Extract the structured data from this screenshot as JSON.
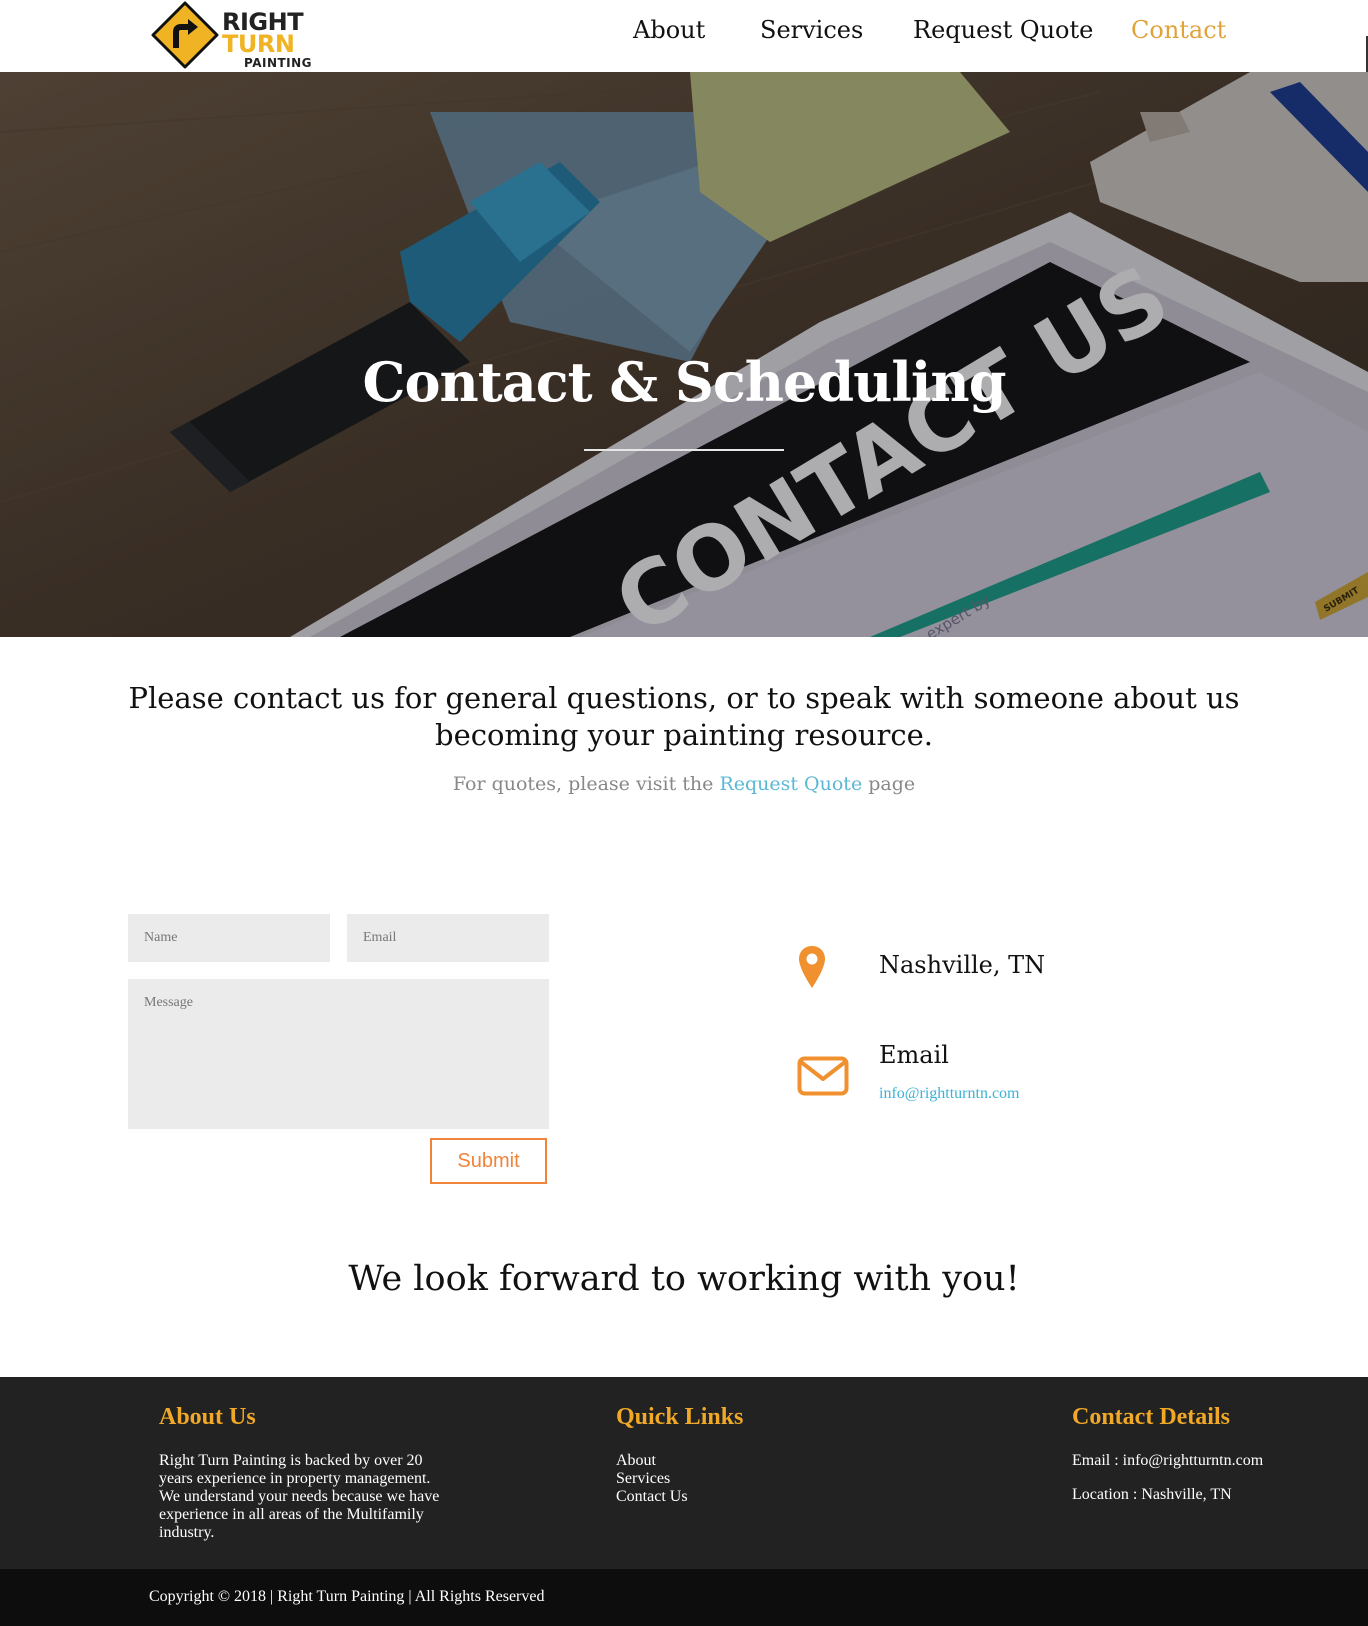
{
  "header": {
    "logo": {
      "line1": "RIGHT",
      "line2": "TURN",
      "line3": "PAINTING",
      "icon": "turn-arrow-sign-icon"
    },
    "nav": {
      "about": "About",
      "services": "Services",
      "request_quote": "Request Quote",
      "contact": "Contact"
    },
    "active_nav": "Contact",
    "active_color": "#e0a33a"
  },
  "hero": {
    "title": "Contact & Scheduling",
    "image_text": "CONTACT US",
    "image_small_text": "an expert by",
    "image_button_text": "SUBMIT"
  },
  "intro": {
    "heading": "Please contact us for general questions, or to speak with someone about us becoming your painting resource.",
    "quote_prefix": "For quotes, please visit the ",
    "quote_link": "Request Quote",
    "quote_suffix": " page"
  },
  "form": {
    "name_placeholder": "Name",
    "email_placeholder": "Email",
    "message_placeholder": "Message",
    "submit_label": "Submit",
    "accent_color": "#f0843a"
  },
  "contact_info": {
    "location": "Nashville, TN",
    "location_icon": "map-pin-icon",
    "email_title": "Email",
    "email_value": "info@rightturntn.com",
    "email_icon": "envelope-icon"
  },
  "closing": "We look forward to working with you!",
  "footer": {
    "about_title": "About Us",
    "about_text": "Right Turn Painting is backed by over 20 years experience in property management. We understand your needs because we have experience in all areas of the Multifamily industry.",
    "links_title": "Quick Links",
    "links": [
      "About",
      "Services",
      "Contact Us"
    ],
    "contact_title": "Contact Details",
    "contact_email": "Email : info@rightturntn.com",
    "contact_location": "Location : Nashville, TN",
    "heading_color": "#f0a826",
    "copyright": "Copyright © 2018 | Right Turn Painting | All Rights Reserved"
  }
}
